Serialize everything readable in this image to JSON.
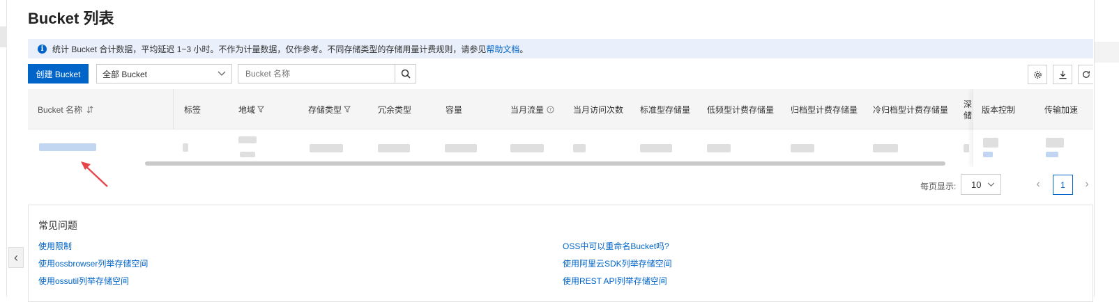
{
  "page": {
    "title": "Bucket 列表"
  },
  "notice": {
    "text": "统计 Bucket 合计数据，平均延迟 1~3 小时。不作为计量数据，仅作参考。不同存储类型的存储用量计费规则，请参见",
    "link": "帮助文档",
    "suffix": "。"
  },
  "toolbar": {
    "create_label": "创建 Bucket",
    "filter_value": "全部 Bucket",
    "search_placeholder": "Bucket 名称"
  },
  "table": {
    "columns": [
      "Bucket 名称",
      "标签",
      "地域",
      "存储类型",
      "冗余类型",
      "容量",
      "当月流量",
      "当月访问次数",
      "标准型存储量",
      "低频型计费存储量",
      "归档型计费存储量",
      "冷归档型计费存储量",
      "深",
      "储"
    ],
    "fixed_columns": [
      "版本控制",
      "传输加速"
    ],
    "sort_icon": "sort-icon",
    "filter_icon": "filter-icon",
    "help_icon": "question-circle-icon"
  },
  "pagination": {
    "page_size_label": "每页显示:",
    "page_size": "10",
    "current_page": "1"
  },
  "faq": {
    "title": "常见问题",
    "left": [
      "使用限制",
      "使用ossbrowser列举存储空间",
      "使用ossutil列举存储空间"
    ],
    "right": [
      "OSS中可以重命名Bucket吗?",
      "使用阿里云SDK列举存储空间",
      "使用REST API列举存储空间"
    ]
  },
  "colors": {
    "primary": "#0064c8",
    "notice_bg": "#e9f0fb",
    "arrow": "#e8454a"
  }
}
